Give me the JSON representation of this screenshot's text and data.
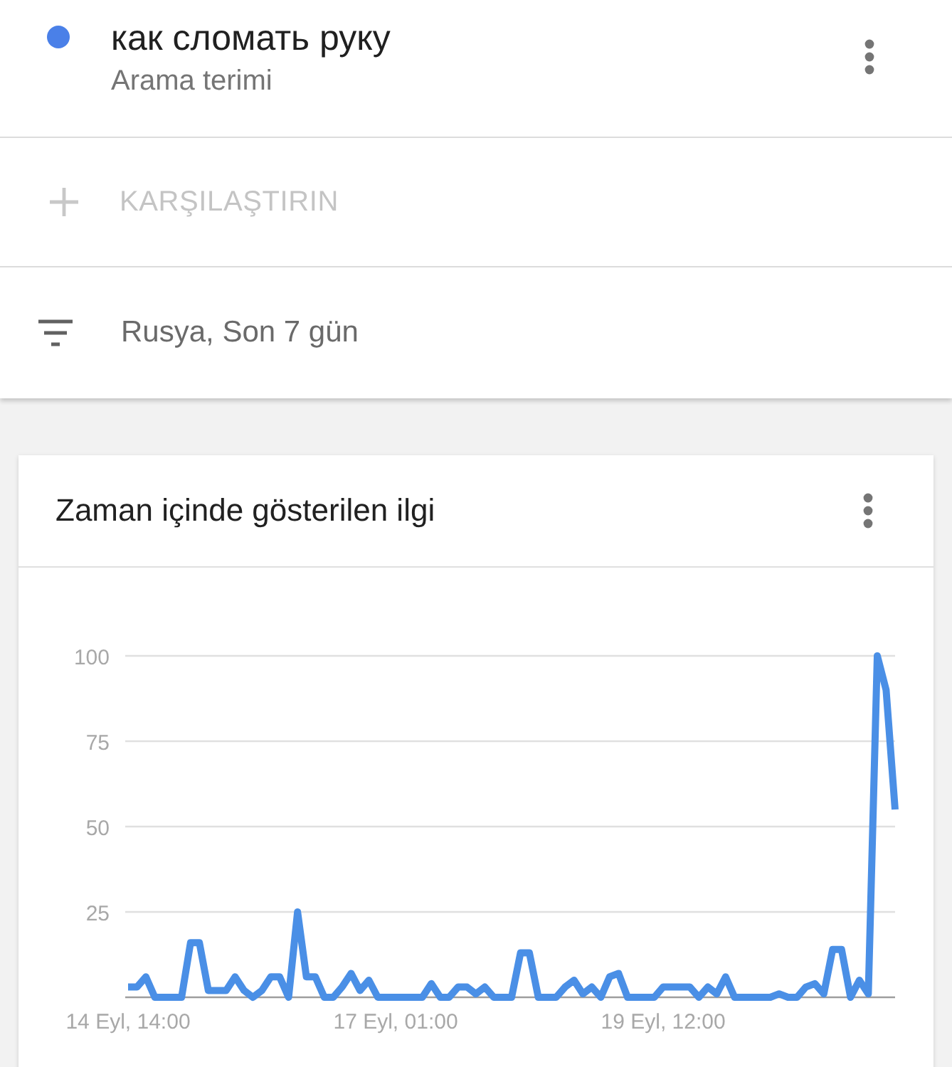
{
  "search_term": {
    "term": "как сломать руку",
    "subtitle": "Arama terimi",
    "color": "#4a80e8"
  },
  "compare": {
    "label": "KARŞILAŞTIRIN"
  },
  "filter": {
    "label": "Rusya, Son 7 gün"
  },
  "interest_card": {
    "title": "Zaman içinde gösterilen ilgi",
    "chart_data": {
      "type": "line",
      "grid": true,
      "ylim": [
        0,
        100
      ],
      "yticks": [
        25,
        50,
        75,
        100
      ],
      "categories": [
        "14 Eyl, 14:00",
        null,
        null,
        null,
        null,
        null,
        null,
        null,
        null,
        null,
        null,
        null,
        null,
        null,
        null,
        null,
        null,
        null,
        null,
        null,
        null,
        null,
        null,
        null,
        null,
        null,
        null,
        null,
        null,
        null,
        "17 Eyl, 01:00",
        null,
        null,
        null,
        null,
        null,
        null,
        null,
        null,
        null,
        null,
        null,
        null,
        null,
        null,
        null,
        null,
        null,
        null,
        null,
        null,
        null,
        null,
        null,
        null,
        null,
        null,
        null,
        null,
        null,
        "19 Eyl, 12:00",
        null,
        null,
        null,
        null,
        null,
        null,
        null,
        null,
        null,
        null,
        null,
        null,
        null,
        null,
        null,
        null,
        null,
        null,
        null,
        null,
        null,
        null,
        null,
        null,
        null,
        null
      ],
      "series": [
        {
          "color": "#4a8fe6",
          "values": [
            3,
            3,
            6,
            0,
            0,
            0,
            0,
            16,
            16,
            2,
            2,
            2,
            6,
            2,
            0,
            2,
            6,
            6,
            0,
            25,
            6,
            6,
            0,
            0,
            3,
            7,
            2,
            5,
            0,
            0,
            0,
            0,
            0,
            0,
            4,
            0,
            0,
            3,
            3,
            1,
            3,
            0,
            0,
            0,
            13,
            13,
            0,
            0,
            0,
            3,
            5,
            1,
            3,
            0,
            6,
            7,
            0,
            0,
            0,
            0,
            3,
            3,
            3,
            3,
            0,
            3,
            1,
            6,
            0,
            0,
            0,
            0,
            0,
            1,
            0,
            0,
            3,
            4,
            1,
            14,
            14,
            0,
            5,
            1,
            100,
            90,
            55
          ]
        }
      ]
    }
  }
}
